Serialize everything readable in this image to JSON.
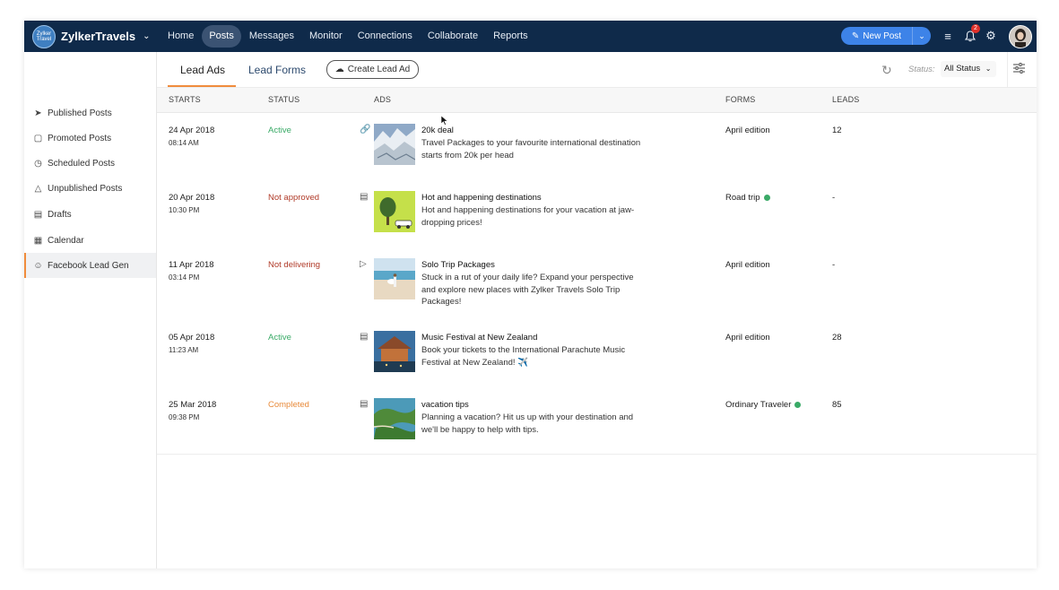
{
  "app": {
    "name": "ZylkerTravels",
    "logo_text": "Zylker Travel"
  },
  "nav": {
    "items": [
      "Home",
      "Posts",
      "Messages",
      "Monitor",
      "Connections",
      "Collaborate",
      "Reports"
    ],
    "active": "Posts",
    "new_post_label": "New Post",
    "notification_count": "2"
  },
  "sidebar": {
    "items": [
      {
        "label": "Published Posts",
        "icon": "send-icon"
      },
      {
        "label": "Promoted Posts",
        "icon": "promote-icon"
      },
      {
        "label": "Scheduled Posts",
        "icon": "clock-icon"
      },
      {
        "label": "Unpublished Posts",
        "icon": "warning-icon"
      },
      {
        "label": "Drafts",
        "icon": "drafts-icon"
      },
      {
        "label": "Calendar",
        "icon": "calendar-icon"
      },
      {
        "label": "Facebook Lead Gen",
        "icon": "lead-gen-icon"
      }
    ],
    "active": "Facebook Lead Gen"
  },
  "tabs": {
    "items": [
      "Lead Ads",
      "Lead Forms"
    ],
    "active": "Lead Ads",
    "create_label": "Create Lead Ad",
    "status_label": "Status:",
    "status_value": "All Status"
  },
  "table": {
    "headers": [
      "STARTS",
      "STATUS",
      "ADS",
      "FORMS",
      "LEADS"
    ],
    "rows": [
      {
        "date": "24 Apr 2018",
        "time": "08:14 AM",
        "status": "Active",
        "status_kind": "active",
        "ad_type": "link-icon",
        "title": "20k deal",
        "desc": "Travel Packages to your favourite international destination starts from 20k per head",
        "form": "April edition",
        "form_dot": false,
        "leads": "12",
        "thumb": "snow"
      },
      {
        "date": "20 Apr 2018",
        "time": "10:30 PM",
        "status": "Not approved",
        "status_kind": "notapproved",
        "ad_type": "image-icon",
        "title": "Hot and happening destinations",
        "desc": "Hot and happening destinations for your vacation at jaw-dropping prices!",
        "form": "Road trip",
        "form_dot": true,
        "leads": "-",
        "thumb": "tree"
      },
      {
        "date": "11 Apr 2018",
        "time": "03:14 PM",
        "status": "Not delivering",
        "status_kind": "notdelivering",
        "ad_type": "video-icon",
        "title": "Solo Trip Packages",
        "desc": "Stuck in a rut of your daily life? Expand your perspective and explore new places with Zylker Travels Solo Trip Packages!",
        "form": "April edition",
        "form_dot": false,
        "leads": "-",
        "thumb": "beach"
      },
      {
        "date": "05 Apr 2018",
        "time": "11:23 AM",
        "status": "Active",
        "status_kind": "active",
        "ad_type": "image-icon",
        "title": "Music Festival at New Zealand",
        "desc": "Book your tickets to the International Parachute Music Festival at New Zealand! ✈️",
        "form": "April edition",
        "form_dot": false,
        "leads": "28",
        "thumb": "hut"
      },
      {
        "date": "25 Mar 2018",
        "time": "09:38 PM",
        "status": "Completed",
        "status_kind": "completed",
        "ad_type": "image-icon",
        "title": "vacation tips",
        "desc": "Planning a vacation? Hit us up with your destination and we'll be happy to help with tips.",
        "form": "Ordinary Traveler",
        "form_dot": true,
        "leads": "85",
        "thumb": "island"
      }
    ]
  },
  "colors": {
    "topbar": "#0f2a4a",
    "accent": "#f08c3c",
    "primary_button": "#3d83e8",
    "active_status": "#3aaa67",
    "error_status": "#b03a28",
    "completed_status": "#e88a3a"
  }
}
